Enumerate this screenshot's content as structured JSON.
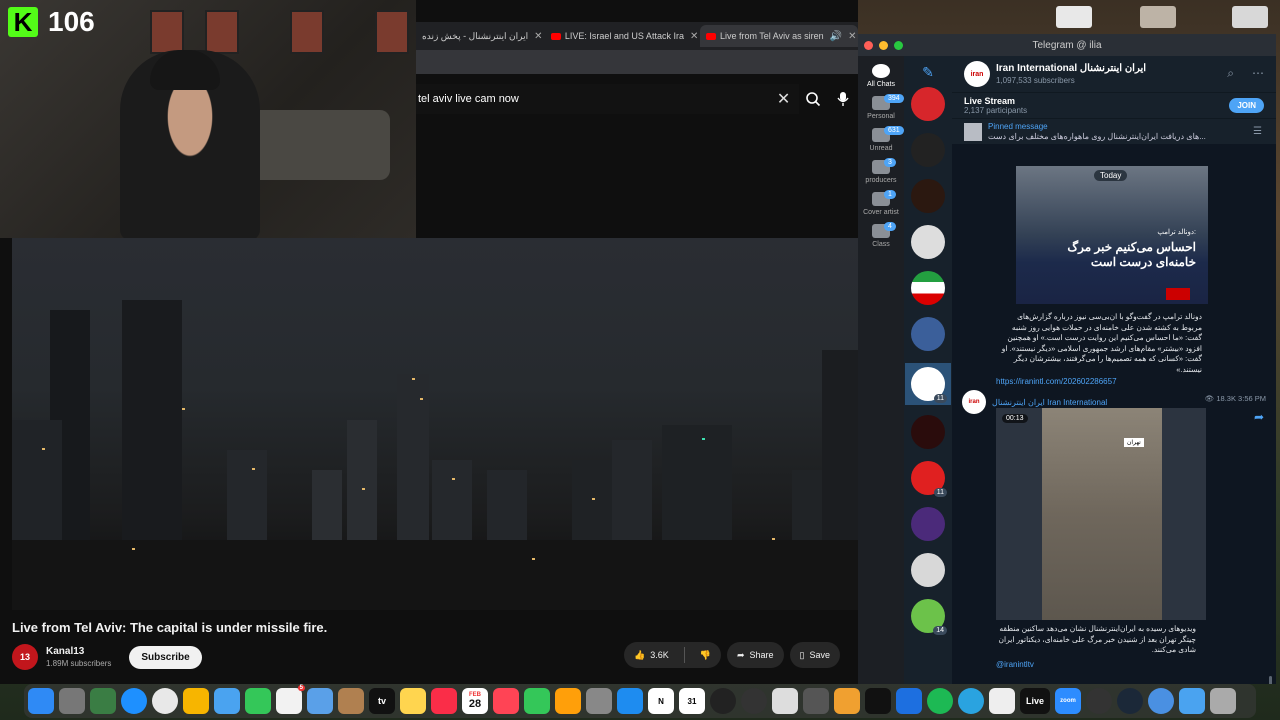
{
  "stream": {
    "platform_letter": "K",
    "viewer_count": "106"
  },
  "browser": {
    "tabs": [
      {
        "label": "ایران اینترنشنال - پخش زنده"
      },
      {
        "label": "LIVE: Israel and US Attack Ira"
      },
      {
        "label": "Live from Tel Aviv as siren"
      }
    ],
    "search_value": "tel aviv live cam now"
  },
  "video": {
    "title": "Live from Tel Aviv: The capital is under missile fire.",
    "channel_name": "Kanal13",
    "channel_avatar_text": "13",
    "subscribers": "1.89M subscribers",
    "subscribe_label": "Subscribe",
    "like_count": "3.6K",
    "share_label": "Share",
    "save_label": "Save"
  },
  "telegram": {
    "window_title": "Telegram @ ilia",
    "folders": [
      {
        "label": "All Chats",
        "badge": ""
      },
      {
        "label": "Personal",
        "badge": "394"
      },
      {
        "label": "Unread",
        "badge": "631"
      },
      {
        "label": "producers",
        "badge": "3"
      },
      {
        "label": "Cover artist",
        "badge": "1"
      },
      {
        "label": "Class",
        "badge": "4"
      }
    ],
    "chat_badges": {
      "selected": "11",
      "red": "11",
      "green": "14"
    },
    "channel": {
      "name": "Iran International ایران اینترنشنال",
      "subscribers": "1,097,533 subscribers",
      "avatar_text": "iran"
    },
    "live_stream": {
      "title": "Live Stream",
      "participants": "2,137 participants",
      "join_label": "JOIN"
    },
    "pinned": {
      "title": "Pinned message",
      "text": "های دریافت ایران‌اینترنشنال روی ماهواره‌های مختلف  برای دست..."
    },
    "post1": {
      "date_badge": "Today",
      "image_caption_small": "دونالد ترامپ:",
      "image_caption_line1": "احساس می‌کنیم خبر مرگ",
      "image_caption_line2": "خامنه‌ای درست است",
      "text": "دونالد ترامپ در گفت‌وگو با ان‌بی‌سی نیوز درباره گزارش‌های مربوط به کشته شدن علی خامنه‌ای در حملات هوایی روز شنبه گفت: «ما احساس می‌کنیم این روایت درست است.» او همچنین افزود «بیشتر» مقام‌های ارشد جمهوری اسلامی «دیگر نیستند». او گفت: «کسانی که همه تصمیم‌ها را می‌گرفتند، بیشترشان دیگر نیستند.»",
      "link": "https://iranintl.com/202602286657"
    },
    "post2": {
      "author": "ایران اینترنشنال Iran International",
      "meta": "18.3K 3:56 PM",
      "duration": "00:13",
      "sign_text": "تهران",
      "text": "ویدیوهای رسیده به ایران‌اینترنشنال نشان می‌دهد ساکنین منطقه چیتگر تهران بعد از شنیدن خبر مرگ علی خامنه‌ای، دیکتاتور ایران شادی می‌کنند.",
      "link": "@iranintltv"
    }
  },
  "dock": {
    "calendar_day": "28",
    "calendar_month": "FEB",
    "messages_badge": "5",
    "tv_label": "tv",
    "live_label": "Live",
    "zoom_label": "zoom"
  }
}
